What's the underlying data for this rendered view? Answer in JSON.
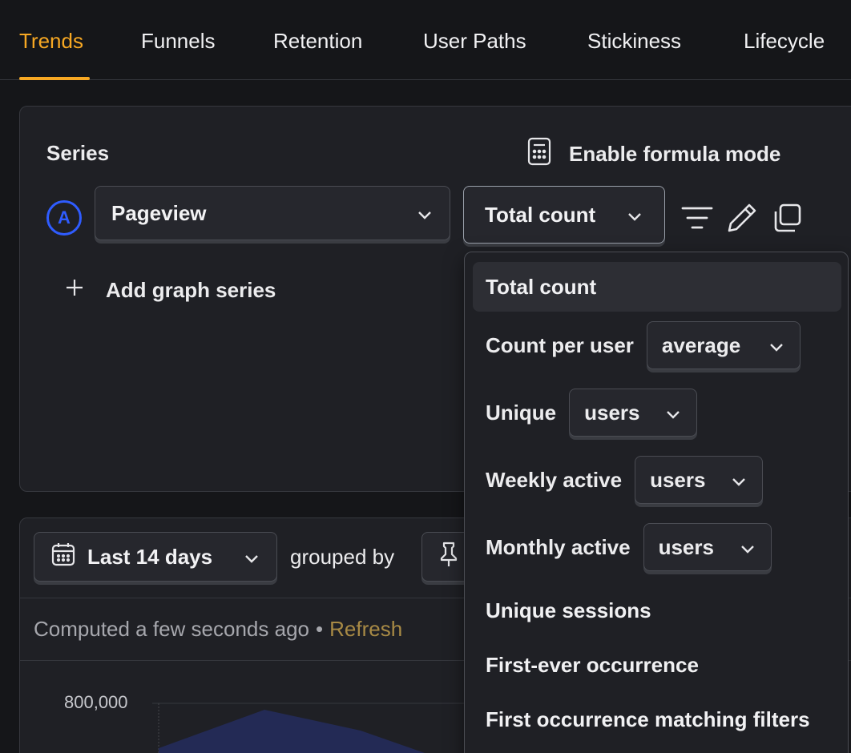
{
  "tabs": [
    {
      "label": "Trends",
      "active": true
    },
    {
      "label": "Funnels"
    },
    {
      "label": "Retention"
    },
    {
      "label": "User Paths"
    },
    {
      "label": "Stickiness"
    },
    {
      "label": "Lifecycle"
    }
  ],
  "series_panel": {
    "title": "Series",
    "formula_label": "Enable formula mode",
    "badge": "A",
    "event_value": "Pageview",
    "math_value": "Total count",
    "add_label": "Add graph series"
  },
  "graph_panel": {
    "date_value": "Last 14 days",
    "grouped_by": "grouped by",
    "computed": "Computed a few seconds ago",
    "separator": "•",
    "refresh": "Refresh",
    "y_tick": "800,000"
  },
  "dropdown": {
    "total_count": "Total count",
    "count_per_user": {
      "label": "Count per user",
      "value": "average"
    },
    "unique": {
      "label": "Unique",
      "value": "users"
    },
    "weekly_active": {
      "label": "Weekly active",
      "value": "users"
    },
    "monthly_active": {
      "label": "Monthly active",
      "value": "users"
    },
    "unique_sessions": "Unique sessions",
    "first_ever": "First-ever occurrence",
    "first_matching": "First occurrence matching filters"
  },
  "colors": {
    "accent": "#f7a823",
    "series_a": "#2f5cff",
    "chart_fill": "#232a55"
  }
}
